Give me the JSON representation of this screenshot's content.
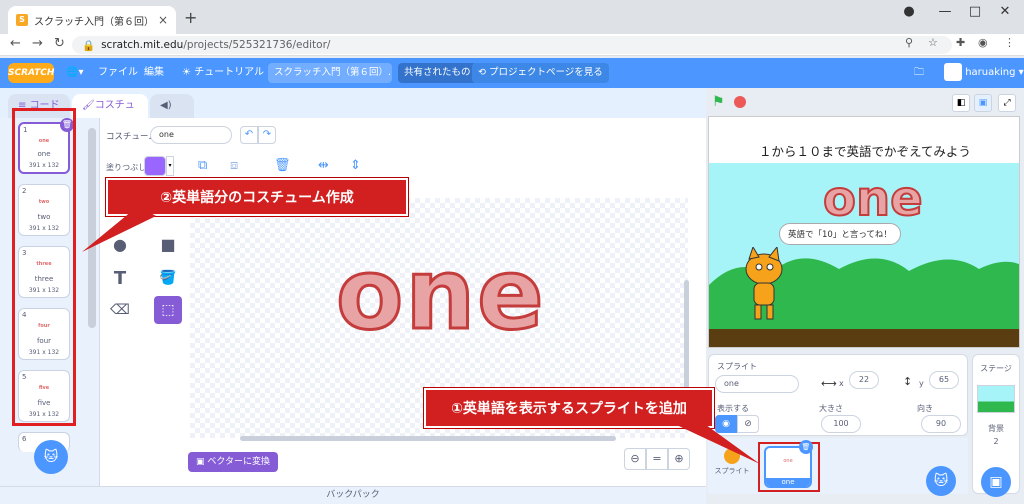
{
  "browser": {
    "tab_title": "スクラッチ入門（第６回）１から１",
    "url_host": "scratch.mit.edu",
    "url_path": "/projects/525321736/editor/"
  },
  "menubar": {
    "file": "ファイル",
    "edit": "編集",
    "tutorials": "チュートリアル",
    "project_title": "スクラッチ入門（第６回）...",
    "shared": "共有されたもの",
    "see_project": "プロジェクトページを見る",
    "username": "haruaking"
  },
  "tabs": {
    "code": "コード",
    "costumes": "コスチューム",
    "sounds": "音"
  },
  "costumes": [
    {
      "num": "1",
      "name": "one",
      "size": "391 x 132"
    },
    {
      "num": "2",
      "name": "two",
      "size": "391 x 132"
    },
    {
      "num": "3",
      "name": "three",
      "size": "391 x 132"
    },
    {
      "num": "4",
      "name": "four",
      "size": "391 x 132"
    },
    {
      "num": "5",
      "name": "five",
      "size": "391 x 132"
    },
    {
      "num": "6",
      "name": "",
      "size": ""
    }
  ],
  "editor": {
    "costume_label": "コスチューム",
    "costume_name": "one",
    "fill_label": "塗りつぶし",
    "fill_color": "#9966ff",
    "canvas_text": "one",
    "convert_button": "ベクターに変換",
    "zoom_eq": "="
  },
  "callouts": {
    "costume": "②英単語分のコスチューム作成",
    "sprite": "①英単語を表示するスプライトを追加"
  },
  "stage": {
    "title": "１から１０まで英語でかぞえてみよう",
    "big_text": "one",
    "bubble": "英語で「10」と言ってね！"
  },
  "sprite_info": {
    "sprite_label": "スプライト",
    "sprite_name": "one",
    "x_label": "x",
    "x_value": "22",
    "y_label": "y",
    "y_value": "65",
    "show_label": "表示する",
    "size_label": "大きさ",
    "size_value": "100",
    "direction_label": "向き",
    "direction_value": "90"
  },
  "sprite_list": {
    "sprite1_name": "スプライト",
    "sprite2_name": "one"
  },
  "stage_pane": {
    "label": "ステージ",
    "backdrops_label": "背景",
    "backdrops_count": "2"
  },
  "backpack": "バックパック"
}
